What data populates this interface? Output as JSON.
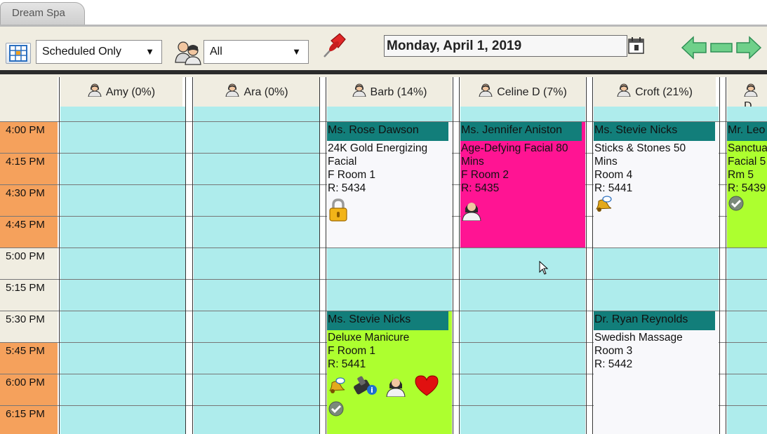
{
  "tab": {
    "label": "Dream Spa"
  },
  "toolbar": {
    "filter_value": "Scheduled Only",
    "staff_value": "All",
    "date": "Monday, April 1, 2019"
  },
  "staff": [
    {
      "name": "Amy (0%)"
    },
    {
      "name": "Ara (0%)"
    },
    {
      "name": "Barb (14%)"
    },
    {
      "name": "Celine D (7%)"
    },
    {
      "name": "Croft (21%)"
    },
    {
      "name": "D"
    }
  ],
  "times": [
    "4:00 PM",
    "4:15 PM",
    "4:30 PM",
    "4:45 PM",
    "5:00 PM",
    "5:15 PM",
    "5:30 PM",
    "5:45 PM",
    "6:00 PM",
    "6:15 PM"
  ],
  "appointments": [
    {
      "client": "Ms. Rose Dawson",
      "service": "24K Gold Energizing",
      "service2": "Facial",
      "room": "F Room 1",
      "ref": "R: 5434"
    },
    {
      "client": "Ms. Jennifer Aniston",
      "service": "Age-Defying Facial 80",
      "service2": "Mins",
      "room": "F Room 2",
      "ref": "R: 5435"
    },
    {
      "client": "Ms. Stevie Nicks",
      "service": "Sticks & Stones 50",
      "service2": "Mins",
      "room": "Room 4",
      "ref": "R: 5441"
    },
    {
      "client": "Mr. Leo",
      "service": "Sanctua",
      "service2": "Facial 5",
      "room": "Rm 5",
      "ref": "R: 5439"
    },
    {
      "client": "Ms. Stevie Nicks",
      "service": "Deluxe Manicure",
      "room": "F Room 1",
      "ref": "R: 5441"
    },
    {
      "client": "Dr. Ryan Reynolds",
      "service": "Swedish Massage",
      "room": "Room 3",
      "ref": "R: 5442"
    }
  ],
  "colors": {
    "slot": "#aeecec",
    "time_column": "#f5a15c",
    "header": "#f0ede1",
    "appt_header": "#127e7a",
    "appt_white": "#f8f8fb",
    "appt_pink": "#ff1493",
    "appt_green": "#adff2f"
  },
  "icons": {
    "lock": "lock-icon",
    "person": "person-icon",
    "bell": "bell-icon",
    "phone": "phone-info-icon",
    "heart": "heart-icon",
    "check": "check-icon",
    "pin": "pushpin-icon",
    "calendar": "calendar-icon"
  }
}
